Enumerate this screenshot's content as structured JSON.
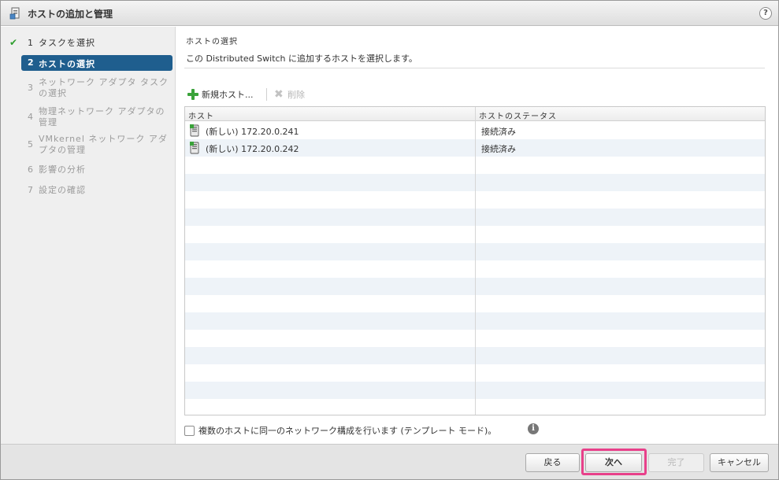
{
  "window": {
    "title": "ホストの追加と管理"
  },
  "sidebar": {
    "steps": [
      {
        "num": "1",
        "label": "タスクを選択"
      },
      {
        "num": "2",
        "label": "ホストの選択"
      },
      {
        "num": "3",
        "label": "ネットワーク アダプタ タスクの選択"
      },
      {
        "num": "4",
        "label": "物理ネットワーク アダプタの管理"
      },
      {
        "num": "5",
        "label": "VMkernel ネットワーク アダプタの管理"
      },
      {
        "num": "6",
        "label": "影響の分析"
      },
      {
        "num": "7",
        "label": "設定の確認"
      }
    ]
  },
  "main": {
    "title": "ホストの選択",
    "description": "この Distributed Switch に追加するホストを選択します。",
    "toolbar": {
      "add_label": "新規ホスト...",
      "delete_label": "削除"
    },
    "table": {
      "headers": [
        "ホスト",
        "ホストのステータス"
      ],
      "rows": [
        {
          "host": "(新しい) 172.20.0.241",
          "status": "接続済み"
        },
        {
          "host": "(新しい) 172.20.0.242",
          "status": "接続済み"
        }
      ]
    },
    "template_checkbox_label": "複数のホストに同一のネットワーク構成を行います (テンプレート モード)。"
  },
  "footer": {
    "back_label": "戻る",
    "next_label": "次へ",
    "finish_label": "完了",
    "cancel_label": "キャンセル"
  },
  "icons": {
    "app": "host-add-icon",
    "help": "help-icon",
    "info": "info-icon",
    "step_done": "checkmark-icon",
    "add": "plus-icon",
    "delete": "x-icon",
    "host": "host-server-icon"
  },
  "colors": {
    "accent": "#1f5e8e",
    "check": "#2e9e2e",
    "highlight": "#e8408a"
  }
}
